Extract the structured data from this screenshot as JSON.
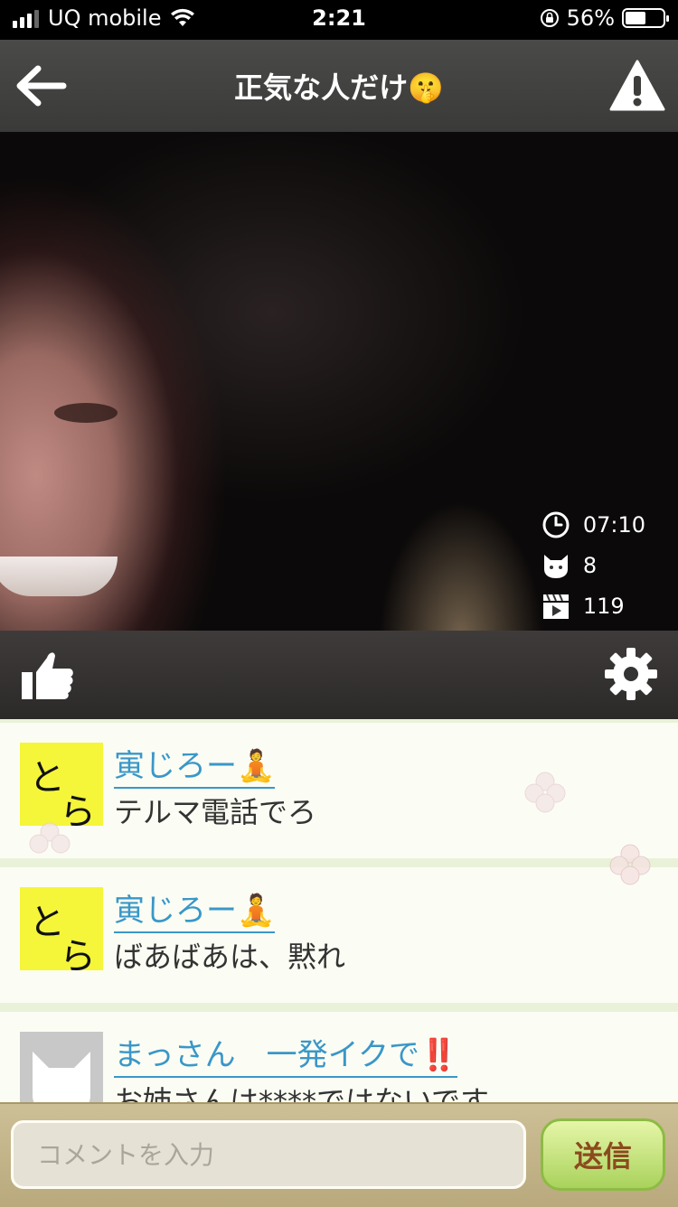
{
  "status_bar": {
    "carrier": "UQ mobile",
    "time": "2:21",
    "battery_percent": "56%",
    "battery_level": 0.56
  },
  "header": {
    "title": "正気な人だけ🤫",
    "back_icon": "arrow-left-icon",
    "report_icon": "warning-icon"
  },
  "video": {
    "stats": {
      "elapsed_time": "07:10",
      "viewers": "8",
      "views": "119"
    }
  },
  "controls": {
    "like_icon": "thumbs-up-icon",
    "settings_icon": "gear-icon"
  },
  "comments": [
    {
      "avatar_text": [
        "と",
        "ら"
      ],
      "username": "寅じろー🧘",
      "message": "テルマ電話でろ"
    },
    {
      "avatar_text": [
        "と",
        "ら"
      ],
      "username": "寅じろー🧘",
      "message": "ばあばあは、黙れ"
    },
    {
      "avatar_icon": "cat-silhouette-icon",
      "username": "まっさん　一発イクで‼️",
      "message": "お姉さんは****ではないです"
    }
  ],
  "input_bar": {
    "placeholder": "コメントを入力",
    "send_label": "送信"
  },
  "colors": {
    "username": "#3a97c8",
    "send_button": "#a9d25c",
    "send_text": "#8b4a1e",
    "avatar_yellow": "#f5f53a"
  }
}
